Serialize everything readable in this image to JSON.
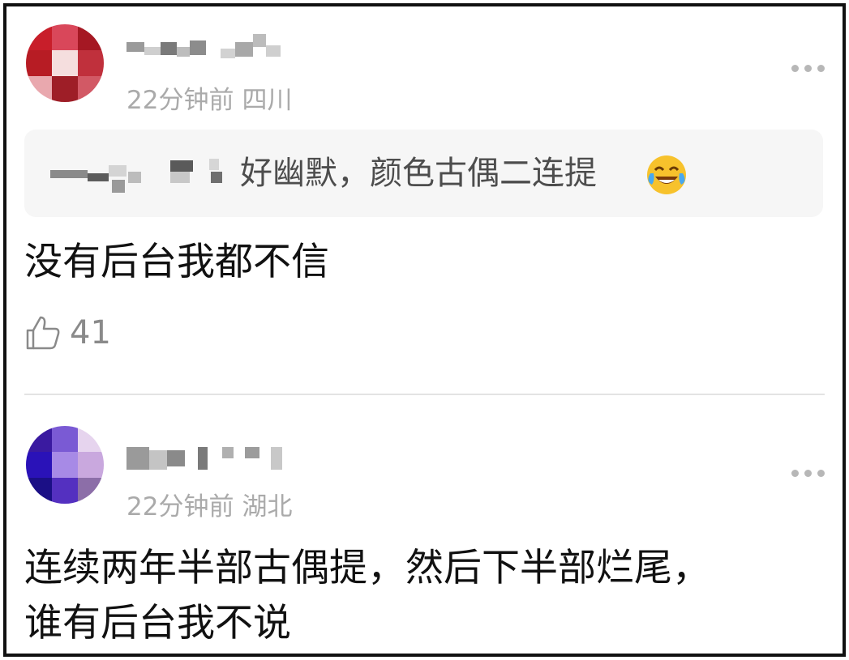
{
  "comments": [
    {
      "time": "22分钟前",
      "location": "四川",
      "quote_text": "好幽默，颜色古偶二连提",
      "body": "没有后台我都不信",
      "likes": "41"
    },
    {
      "time": "22分钟前",
      "location": "湖北",
      "body_line1": "连续两年半部古偶提，然后下半部烂尾，",
      "body_line2": "谁有后台我不说"
    }
  ],
  "icons": {
    "more": "more-dots-icon",
    "like": "thumbs-up-icon",
    "emoji": "laughing-tears-emoji"
  },
  "colors": {
    "text": "#111111",
    "meta": "#aaaaaa",
    "quote_bg": "#f6f6f6",
    "border": "#111111"
  }
}
